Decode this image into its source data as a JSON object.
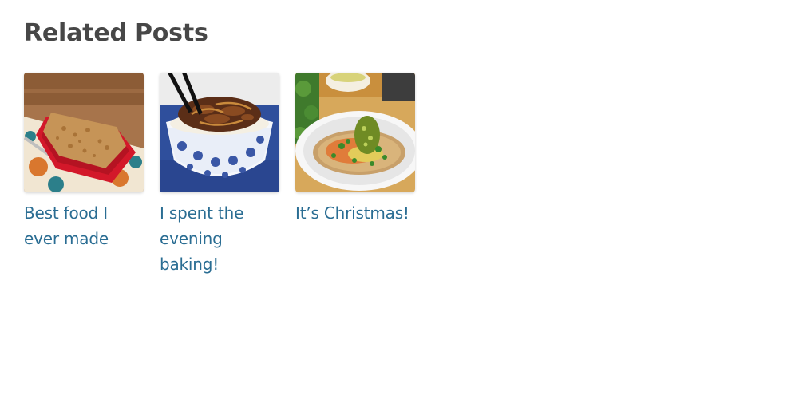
{
  "section": {
    "heading": "Related Posts"
  },
  "posts": [
    {
      "title": "Best food I ever made"
    },
    {
      "title": "I spent the evening baking!"
    },
    {
      "title": "It’s Christmas!"
    }
  ],
  "colors": {
    "heading": "#474747",
    "link": "#2a6d93",
    "background": "#ffffff"
  }
}
